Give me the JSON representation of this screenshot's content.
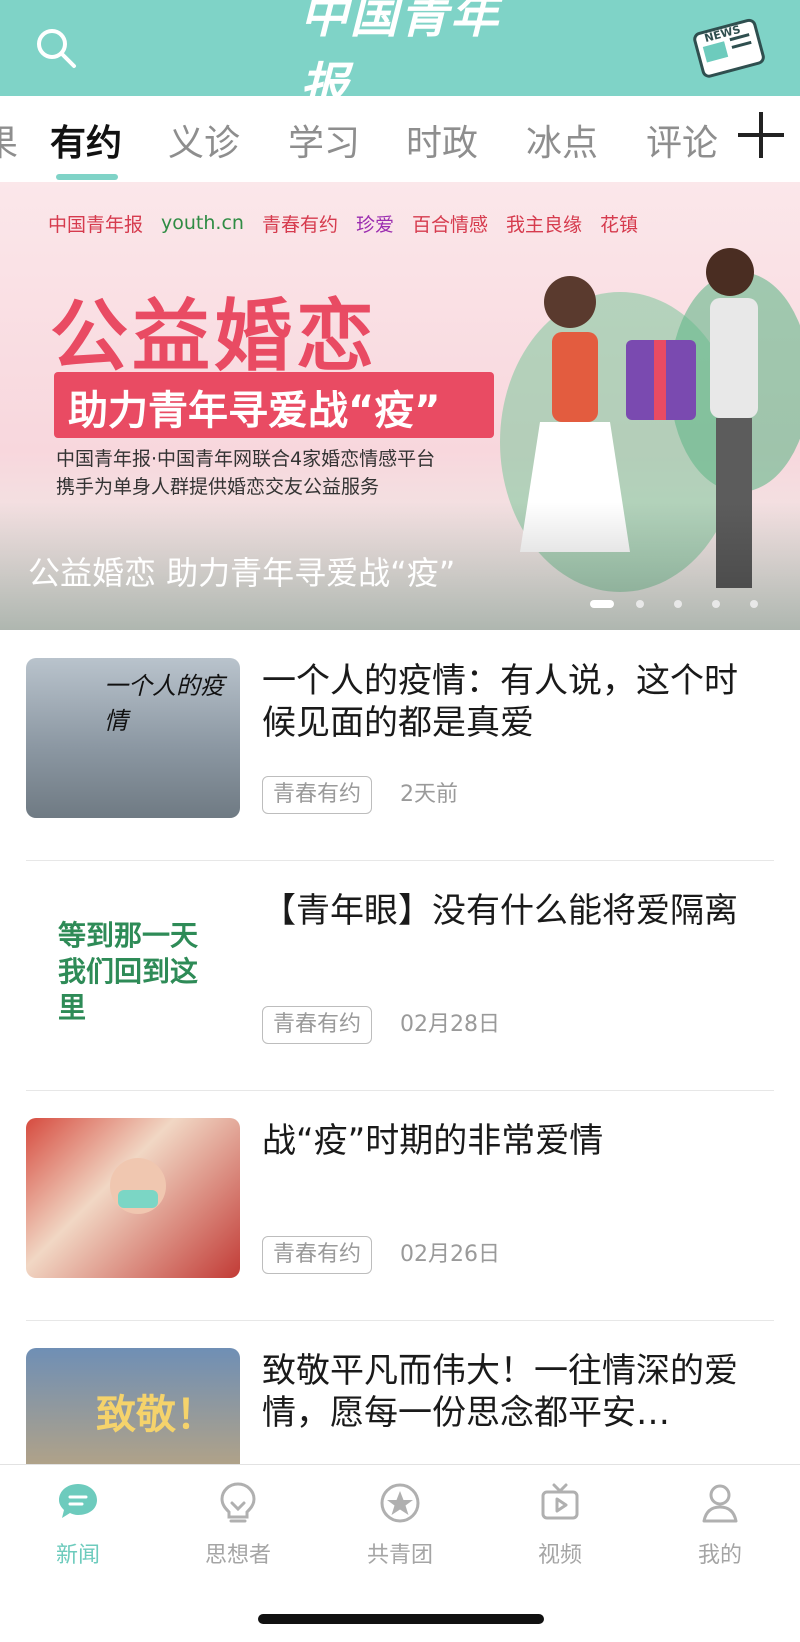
{
  "header": {
    "logo_text": "中国青年报",
    "search_icon": "search-icon",
    "news_icon": "news-icon",
    "news_badge": "NEWS"
  },
  "tabs": {
    "items": [
      "果",
      "有约",
      "义诊",
      "学习",
      "时政",
      "冰点",
      "评论"
    ],
    "active": "有约",
    "add_icon": "plus-icon"
  },
  "banner": {
    "partners": [
      "中国青年报",
      "youth.cn",
      "青春有约",
      "珍爱",
      "百合情感",
      "我主良缘",
      "花镇"
    ],
    "headline": "公益婚恋",
    "subheadline": "助力青年寻爱战“疫”",
    "desc_line1": "中国青年报·中国青年网联合4家婚恋情感平台",
    "desc_line2": "携手为单身人群提供婚恋交友公益服务",
    "caption": "公益婚恋 助力青年寻爱战“疫”",
    "dots_total": 5,
    "dots_active_index": 0
  },
  "feed": [
    {
      "title": "一个人的疫情：有人说，这个时候见面的都是真爱",
      "tag": "青春有约",
      "time": "2天前",
      "thumb_text": "一个人的疫情"
    },
    {
      "title": "【青年眼】没有什么能将爱隔离",
      "tag": "青春有约",
      "time": "02月28日",
      "thumb_text": "等到那一天我们回到这里"
    },
    {
      "title": "战“疫”时期的非常爱情",
      "tag": "青春有约",
      "time": "02月26日",
      "thumb_text": ""
    },
    {
      "title": "致敬平凡而伟大！一往情深的爱情，愿每一份思念都平安…",
      "tag": "",
      "time": "",
      "thumb_text": "致敬！"
    }
  ],
  "bottom_nav": {
    "items": [
      {
        "label": "新闻",
        "icon": "chat-bubble-icon",
        "active": true
      },
      {
        "label": "思想者",
        "icon": "lightbulb-icon",
        "active": false
      },
      {
        "label": "共青团",
        "icon": "star-badge-icon",
        "active": false
      },
      {
        "label": "视频",
        "icon": "tv-play-icon",
        "active": false
      },
      {
        "label": "我的",
        "icon": "person-icon",
        "active": false
      }
    ]
  },
  "colors": {
    "brand": "#7fd3c7",
    "active_nav": "#6dcbbd",
    "banner_pink": "#e94b63"
  }
}
